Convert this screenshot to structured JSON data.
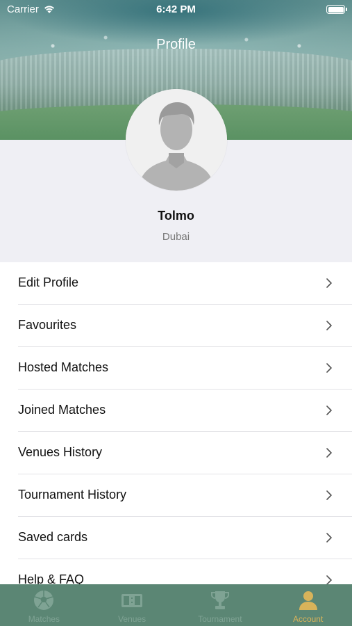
{
  "status_bar": {
    "carrier": "Carrier",
    "time": "6:42 PM"
  },
  "header": {
    "title": "Profile"
  },
  "profile": {
    "name": "Tolmo",
    "city": "Dubai"
  },
  "menu": {
    "items": [
      {
        "label": "Edit Profile"
      },
      {
        "label": "Favourites"
      },
      {
        "label": "Hosted Matches"
      },
      {
        "label": "Joined Matches"
      },
      {
        "label": "Venues History"
      },
      {
        "label": "Tournament History"
      },
      {
        "label": "Saved cards"
      },
      {
        "label": "Help & FAQ"
      }
    ]
  },
  "tab_bar": {
    "tabs": [
      {
        "label": "Matches",
        "icon": "soccer-ball-icon",
        "active": false
      },
      {
        "label": "Venues",
        "icon": "scoreboard-icon",
        "active": false
      },
      {
        "label": "Tournament",
        "icon": "trophy-icon",
        "active": false
      },
      {
        "label": "Account",
        "icon": "user-icon",
        "active": true
      }
    ]
  },
  "colors": {
    "tab_bar_bg": "#5b8674",
    "tab_inactive": "#7fa394",
    "tab_active": "#d8b35a",
    "header_text": "#ffffff"
  }
}
